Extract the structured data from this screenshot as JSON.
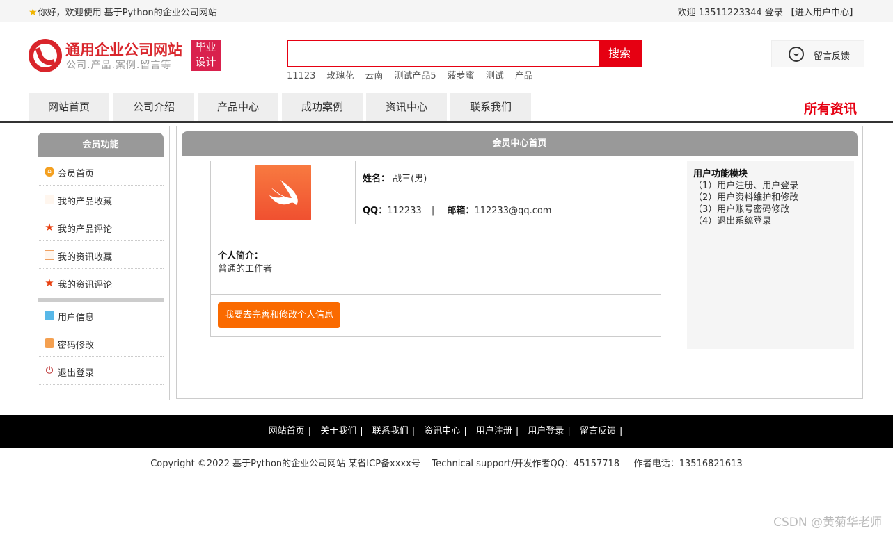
{
  "topbar": {
    "welcome": "你好，欢迎使用 基于Python的企业公司网站",
    "welcome_user": "欢迎 13511223344",
    "login": "登录",
    "user_center": "【进入用户中心】"
  },
  "header": {
    "logo_title": "通用企业公司网站",
    "logo_subtitle": "公司.产品.案例.留言等",
    "badge_line1": "毕业",
    "badge_line2": "设计",
    "search_placeholder": "",
    "search_button": "搜索",
    "hot_words": [
      "11123",
      "玫瑰花",
      "云南",
      "测试产品5",
      "菠萝蜜",
      "测试",
      "产品"
    ],
    "feedback": "留言反馈"
  },
  "nav": {
    "tabs": [
      "网站首页",
      "公司介绍",
      "产品中心",
      "成功案例",
      "资讯中心",
      "联系我们"
    ],
    "all_news": "所有资讯"
  },
  "sidebar": {
    "title": "会员功能",
    "items": [
      "会员首页",
      "我的产品收藏",
      "我的产品评论",
      "我的资讯收藏",
      "我的资讯评论"
    ],
    "items2": [
      "用户信息",
      "密码修改",
      "退出登录"
    ]
  },
  "main": {
    "title": "会员中心首页",
    "name_label": "姓名：",
    "name_value": "战三(男)",
    "qq_label": "QQ：",
    "qq_value": "112233",
    "sep": "|",
    "email_label": "邮箱：",
    "email_value": "112233@qq.com",
    "intro_label": "个人简介：",
    "intro_value": "普通的工作者",
    "edit_button": "我要去完善和修改个人信息"
  },
  "modules": {
    "title": "用户功能模块",
    "items": [
      "（1）用户注册、用户登录",
      "（2）用户资料维护和修改",
      "（3）用户账号密码修改",
      "（4）退出系统登录"
    ]
  },
  "footer": {
    "links": [
      "网站首页",
      "关于我们",
      "联系我们",
      "资讯中心",
      "用户注册",
      "用户登录",
      "留言反馈"
    ],
    "separator": "|",
    "copyright": "Copyright ©2022 基于Python的企业公司网站 某省ICP备xxxx号    Technical support/开发作者QQ：45157718     作者电话：13516821613"
  },
  "watermark": "CSDN @黄菊华老师",
  "colors": {
    "accent": "#e60012",
    "button": "#fa6a00",
    "panel_header": "#999999"
  }
}
